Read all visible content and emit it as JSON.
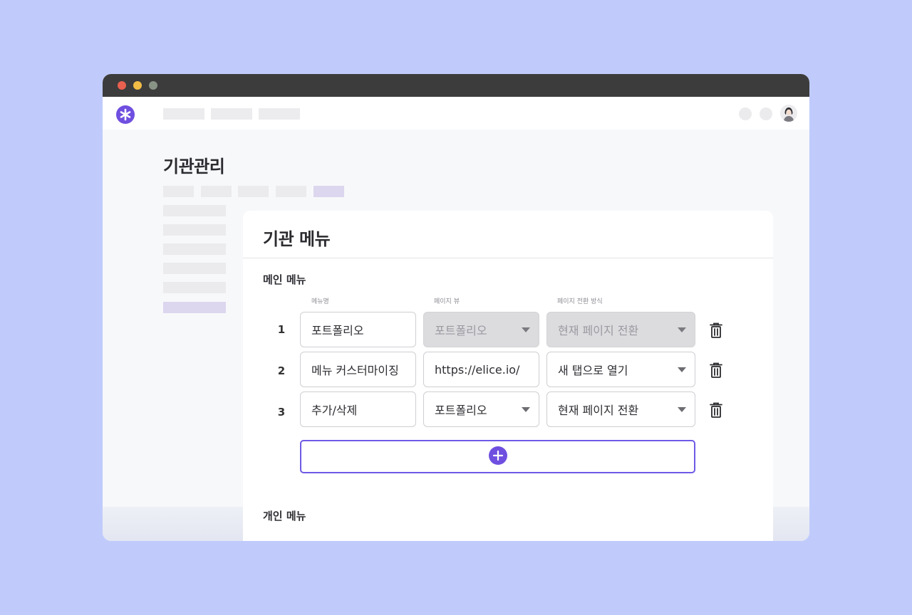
{
  "window_controls": {
    "red": "#e8604f",
    "yellow": "#f2bd46",
    "gray": "#889285"
  },
  "brand": {
    "accent": "#6f4fe0"
  },
  "page": {
    "title": "기관관리"
  },
  "card": {
    "title": "기관 메뉴",
    "main_section": "메인 메뉴",
    "personal_section": "개인 메뉴",
    "columns": [
      "메뉴명",
      "페이지 뷰",
      "페이지 전환 방식"
    ],
    "rows": [
      {
        "num": "1",
        "name": "포트폴리오",
        "view": "포트폴리오",
        "transition": "현재 페이지 전환",
        "disabled": true
      },
      {
        "num": "2",
        "name": "메뉴 커스터마이징",
        "view": "https://elice.io/",
        "transition": "새 탭으로 열기",
        "disabled": false
      },
      {
        "num": "3",
        "name": "추가/삭제",
        "view": "포트폴리오",
        "transition": "현재 페이지 전환",
        "disabled": false
      }
    ],
    "icons": {
      "delete": "trash-icon",
      "add": "plus-circle-icon"
    }
  }
}
